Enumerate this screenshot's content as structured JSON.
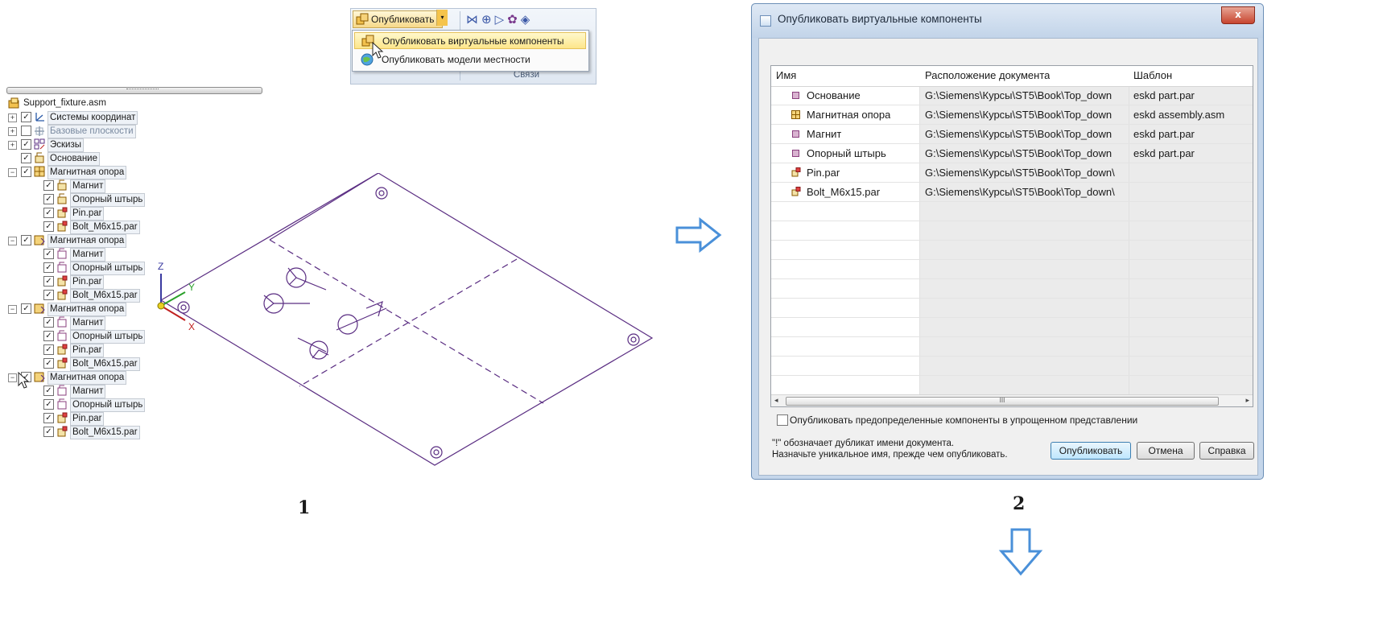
{
  "tree": {
    "items": [
      {
        "label": "Support_fixture.asm",
        "checked": null,
        "expander": null,
        "icon": "assembly-root-icon",
        "indent": 0
      },
      {
        "label": "Системы координат",
        "checked": true,
        "expander": "+",
        "icon": "coordinate-system-icon",
        "indent": 0
      },
      {
        "label": "Базовые плоскости",
        "checked": false,
        "expander": "+",
        "icon": "reference-plane-icon",
        "indent": 0,
        "muted": true
      },
      {
        "label": "Эскизы",
        "checked": true,
        "expander": "+",
        "icon": "sketch-icon",
        "indent": 0
      },
      {
        "label": "Основание",
        "checked": true,
        "expander": null,
        "icon": "virtual-part-icon",
        "indent": 0
      },
      {
        "label": "Магнитная опора",
        "checked": true,
        "expander": "−",
        "icon": "virtual-assembly-icon",
        "indent": 0
      },
      {
        "label": "Магнит",
        "checked": true,
        "expander": null,
        "icon": "virtual-part-icon",
        "indent": 1
      },
      {
        "label": "Опорный штырь",
        "checked": true,
        "expander": null,
        "icon": "virtual-part-icon",
        "indent": 1
      },
      {
        "label": "Pin.par",
        "checked": true,
        "expander": null,
        "icon": "standard-part-icon",
        "indent": 1
      },
      {
        "label": "Bolt_M6x15.par",
        "checked": true,
        "expander": null,
        "icon": "standard-part-icon",
        "indent": 1
      },
      {
        "label": "Магнитная опора",
        "checked": true,
        "expander": "−",
        "icon": "assembly-pattern-icon",
        "indent": 0
      },
      {
        "label": "Магнит",
        "checked": true,
        "expander": null,
        "icon": "part-occurrence-icon",
        "indent": 1
      },
      {
        "label": "Опорный штырь",
        "checked": true,
        "expander": null,
        "icon": "part-occurrence-icon",
        "indent": 1
      },
      {
        "label": "Pin.par",
        "checked": true,
        "expander": null,
        "icon": "standard-part-icon",
        "indent": 1
      },
      {
        "label": "Bolt_M6x15.par",
        "checked": true,
        "expander": null,
        "icon": "standard-part-icon",
        "indent": 1
      },
      {
        "label": "Магнитная опора",
        "checked": true,
        "expander": "−",
        "icon": "assembly-pattern-icon",
        "indent": 0
      },
      {
        "label": "Магнит",
        "checked": true,
        "expander": null,
        "icon": "part-occurrence-icon",
        "indent": 1
      },
      {
        "label": "Опорный штырь",
        "checked": true,
        "expander": null,
        "icon": "part-occurrence-icon",
        "indent": 1
      },
      {
        "label": "Pin.par",
        "checked": true,
        "expander": null,
        "icon": "standard-part-icon",
        "indent": 1
      },
      {
        "label": "Bolt_M6x15.par",
        "checked": true,
        "expander": null,
        "icon": "standard-part-icon",
        "indent": 1
      },
      {
        "label": "Магнитная опора",
        "checked": true,
        "expander": "−",
        "icon": "assembly-pattern-icon",
        "indent": 0
      },
      {
        "label": "Магнит",
        "checked": true,
        "expander": null,
        "icon": "part-occurrence-icon",
        "indent": 1
      },
      {
        "label": "Опорный штырь",
        "checked": true,
        "expander": null,
        "icon": "part-occurrence-icon",
        "indent": 1
      },
      {
        "label": "Pin.par",
        "checked": true,
        "expander": null,
        "icon": "standard-part-icon",
        "indent": 1
      },
      {
        "label": "Bolt_M6x15.par",
        "checked": true,
        "expander": null,
        "icon": "standard-part-icon",
        "indent": 1
      }
    ]
  },
  "ribbon": {
    "publish_button": "Опубликовать",
    "menu": [
      {
        "label": "Опубликовать виртуальные компоненты",
        "highlighted": true
      },
      {
        "label": "Опубликовать модели местности",
        "highlighted": false
      }
    ],
    "group_label": "Связи"
  },
  "viewport": {
    "axis_x": "X",
    "axis_y": "Y",
    "axis_z": "Z"
  },
  "dialog": {
    "title": "Опубликовать виртуальные компоненты",
    "close_label": "x",
    "columns": [
      "Имя",
      "Расположение документа",
      "Шаблон"
    ],
    "rows": [
      {
        "name": "Основание",
        "location": "G:\\Siemens\\Курсы\\ST5\\Book\\Top_down",
        "template": "eskd part.par",
        "icon": "virtual-part-icon"
      },
      {
        "name": "Магнитная опора",
        "location": "G:\\Siemens\\Курсы\\ST5\\Book\\Top_down",
        "template": "eskd assembly.asm",
        "icon": "virtual-assembly-icon"
      },
      {
        "name": "Магнит",
        "location": "G:\\Siemens\\Курсы\\ST5\\Book\\Top_down",
        "template": "eskd part.par",
        "icon": "virtual-part-icon"
      },
      {
        "name": "Опорный штырь",
        "location": "G:\\Siemens\\Курсы\\ST5\\Book\\Top_down",
        "template": "eskd part.par",
        "icon": "virtual-part-icon"
      },
      {
        "name": "Pin.par",
        "location": "G:\\Siemens\\Курсы\\ST5\\Book\\Top_down\\",
        "template": "",
        "icon": "standard-part-icon"
      },
      {
        "name": "Bolt_M6x15.par",
        "location": "G:\\Siemens\\Курсы\\ST5\\Book\\Top_down\\",
        "template": "",
        "icon": "standard-part-icon"
      }
    ],
    "scroll_grip": "III",
    "simplified_checkbox": "Опубликовать предопределенные компоненты в упрощенном представлении",
    "note_line1": "\"!\" обозначает дубликат имени документа.",
    "note_line2": "Назначьте уникальное имя, прежде чем опубликовать.",
    "publish_button": "Опубликовать",
    "cancel_button": "Отмена",
    "help_button": "Справка"
  },
  "captions": {
    "step1": "1",
    "step2": "2"
  },
  "colors": {
    "arrow": "#4a90d9",
    "sketch": "#5a2d82",
    "part_icon": "#8a3f7e",
    "ribbon_highlight": "#fde68a"
  }
}
